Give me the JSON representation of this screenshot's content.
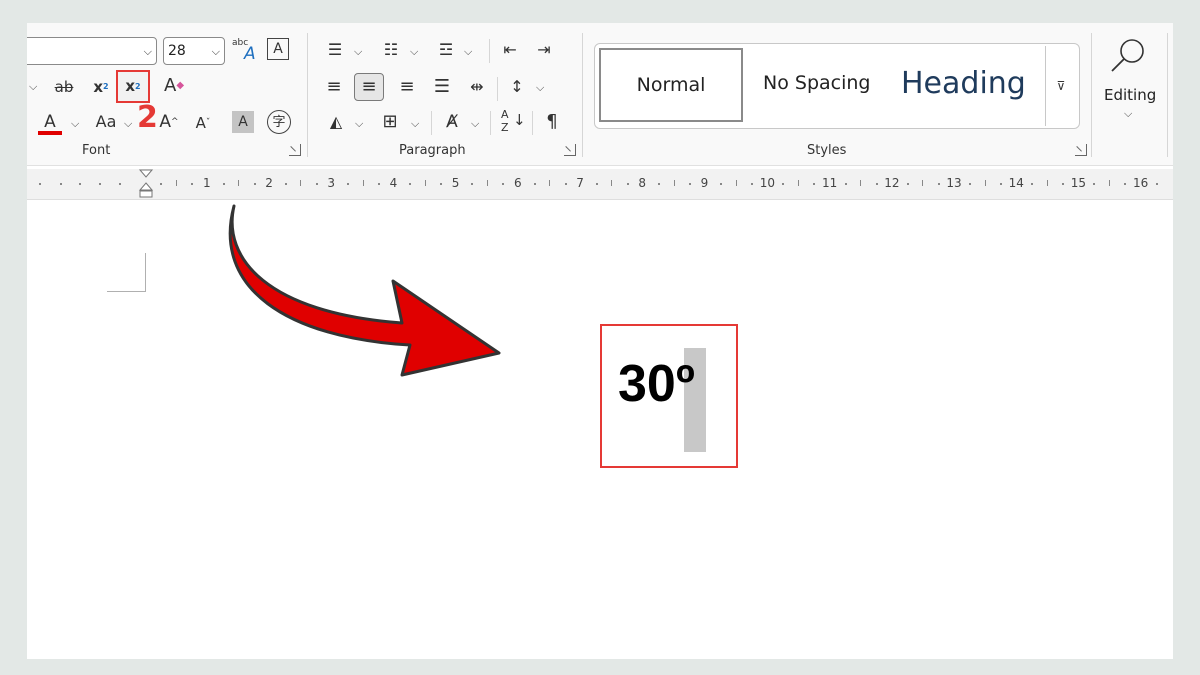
{
  "ribbon": {
    "font": {
      "font_size_value": "28",
      "group_label": "Font",
      "buttons": {
        "strikethrough": "ab",
        "subscript": "x",
        "subscript_mark": "2",
        "superscript": "x",
        "superscript_mark": "2",
        "clear_formatting": "A",
        "font_color": "A",
        "change_case": "Aa",
        "grow_font": "A",
        "shrink_font": "A",
        "text_highlight": "A",
        "enclose_char": "字",
        "text_effects": "A",
        "text_effects_sup": "abc"
      },
      "step_number": "2"
    },
    "paragraph": {
      "group_label": "Paragraph",
      "buttons": {
        "sort": "A",
        "sort_z": "Z",
        "show_marks": "¶"
      }
    },
    "styles": {
      "group_label": "Styles",
      "items": [
        "Normal",
        "No Spacing",
        "Heading 1"
      ]
    },
    "editing": {
      "label": "Editing"
    }
  },
  "ruler": {
    "numbers": [
      "1",
      "2",
      "3",
      "4",
      "5",
      "6",
      "7",
      "8",
      "9",
      "10",
      "11",
      "12",
      "13",
      "14",
      "15",
      "16"
    ]
  },
  "document": {
    "result_text": "30º"
  },
  "colors": {
    "accent_red": "#e53935",
    "arrow_red": "#e00000",
    "heading_blue": "#1f3b5c",
    "selection_gray": "#c8c8c8"
  },
  "icons": [
    "chevron-down-icon",
    "strikethrough-icon",
    "subscript-icon",
    "superscript-icon",
    "clear-formatting-icon",
    "font-color-icon",
    "change-case-icon",
    "grow-font-icon",
    "shrink-font-icon",
    "highlight-icon",
    "enclose-char-icon",
    "bullets-icon",
    "numbering-icon",
    "multilevel-list-icon",
    "decrease-indent-icon",
    "increase-indent-icon",
    "align-left-icon",
    "align-center-icon",
    "align-right-icon",
    "justify-icon",
    "distributed-icon",
    "line-spacing-icon",
    "shading-icon",
    "borders-icon",
    "text-direction-icon",
    "sort-icon",
    "paragraph-mark-icon",
    "search-icon",
    "arrow-icon"
  ]
}
